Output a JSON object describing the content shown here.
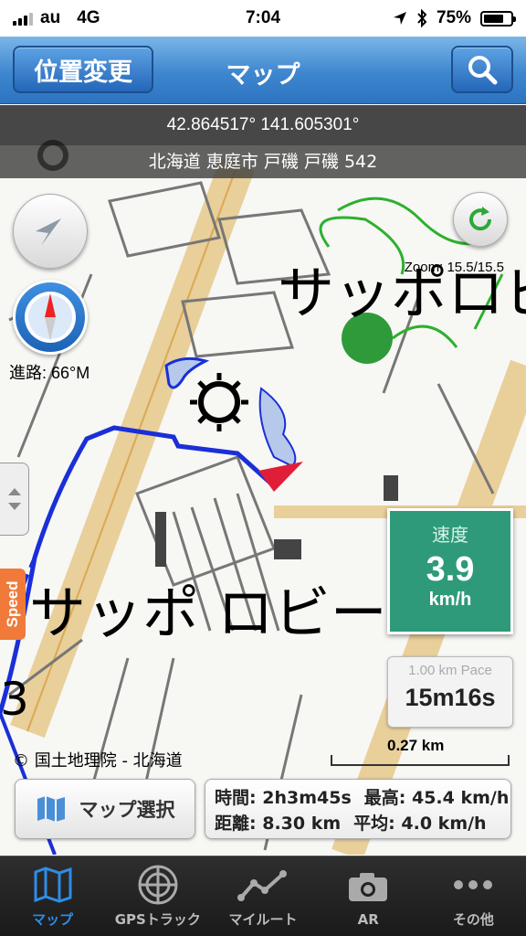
{
  "status_bar": {
    "carrier": "au",
    "network": "4G",
    "time": "7:04",
    "battery": "75%",
    "battery_level": 0.75
  },
  "nav": {
    "left_button": "位置変更",
    "title": "マップ",
    "search_icon": "search-icon"
  },
  "info": {
    "coords": "42.864517° 141.605301°",
    "address": "北海道 恵庭市 戸磯 戸磯 542"
  },
  "map": {
    "zoom": "Zoom: 15.5/15.5",
    "heading": "進路: 66°M",
    "label_top": "サッポロビ",
    "label_bottom": "サッポ ロビー",
    "label_num": "3",
    "copyright": "© 国土地理院 - 北海道",
    "speed_tab": "Speed",
    "speed_card": {
      "label": "速度",
      "value": "3.9",
      "unit": "km/h"
    },
    "pace_card": {
      "label": "1.00 km Pace",
      "value": "15m16s"
    },
    "scale": "0.27 km",
    "map_select": "マップ選択",
    "stats": {
      "time_label": "時間:",
      "time_value": "2h3m45s",
      "max_label": "最高:",
      "max_value": "45.4 km/h",
      "dist_label": "距離:",
      "dist_value": "8.30 km",
      "avg_label": "平均:",
      "avg_value": "4.0 km/h"
    }
  },
  "tabs": [
    {
      "label": "マップ",
      "icon": "map-icon",
      "active": true
    },
    {
      "label": "GPSトラック",
      "icon": "radar-icon",
      "active": false
    },
    {
      "label": "マイルート",
      "icon": "route-icon",
      "active": false
    },
    {
      "label": "AR",
      "icon": "camera-icon",
      "active": false
    },
    {
      "label": "その他",
      "icon": "more-icon",
      "active": false
    }
  ],
  "colors": {
    "nav": "#3e86cf",
    "track": "#1a2fd8",
    "speed_card": "#2e9a7a",
    "speed_tab": "#f07a3a",
    "tab_active": "#2e8de8"
  }
}
